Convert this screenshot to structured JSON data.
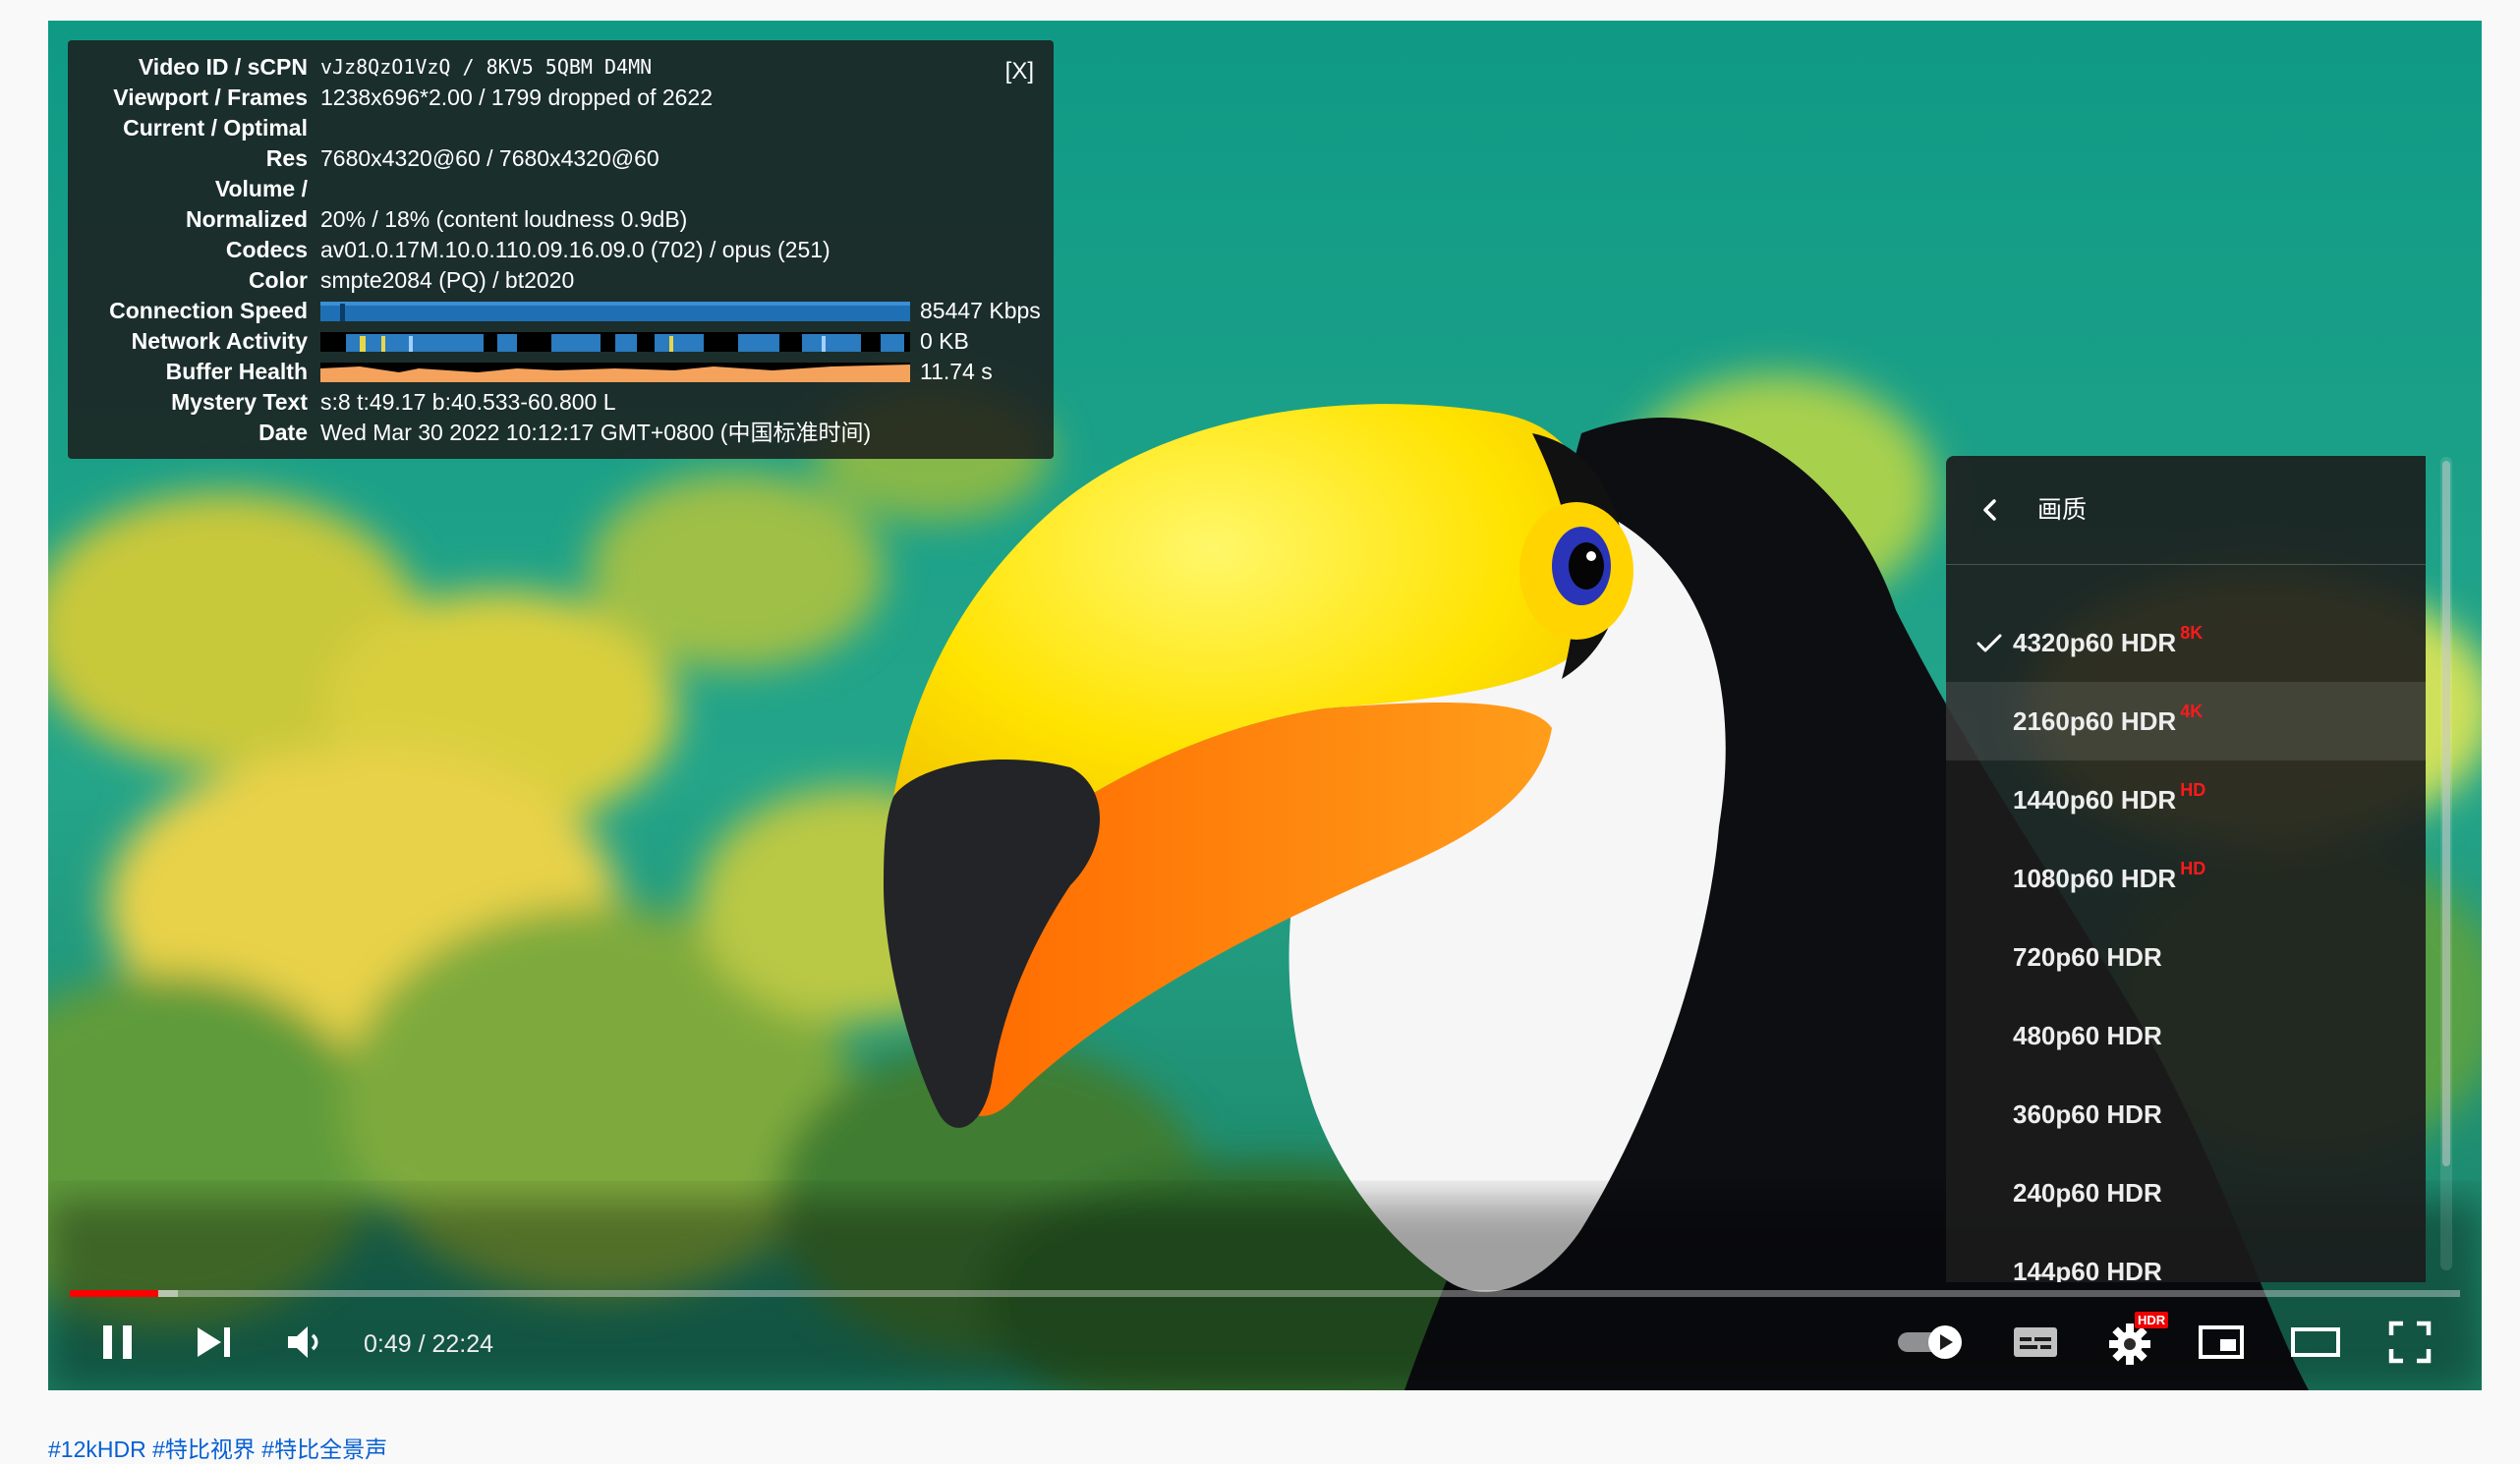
{
  "stats": {
    "close_label": "[X]",
    "rows": [
      {
        "label": "Video ID / sCPN",
        "value": "vJz8QzO1VzQ  /  8KV5 5QBM D4MN"
      },
      {
        "label": "Viewport / Frames",
        "value": "1238x696*2.00 / 1799 dropped of 2622"
      },
      {
        "label": "Current / Optimal",
        "value": ""
      },
      {
        "label": "Res",
        "value": "7680x4320@60 / 7680x4320@60"
      },
      {
        "label": "Volume /",
        "value": ""
      },
      {
        "label": "Normalized",
        "value": "20% / 18% (content loudness 0.9dB)"
      },
      {
        "label": "Codecs",
        "value": "av01.0.17M.10.0.110.09.16.09.0 (702) / opus (251)"
      },
      {
        "label": "Color",
        "value": "smpte2084 (PQ) / bt2020"
      },
      {
        "label": "Connection Speed",
        "value": "85447 Kbps"
      },
      {
        "label": "Network Activity",
        "value": "0 KB"
      },
      {
        "label": "Buffer Health",
        "value": "11.74 s"
      },
      {
        "label": "Mystery Text",
        "value": "s:8 t:49.17 b:40.533-60.800 L"
      },
      {
        "label": "Date",
        "value": "Wed Mar 30 2022 10:12:17 GMT+0800 (中国标准时间)"
      }
    ]
  },
  "quality_menu": {
    "title": "画质",
    "items": [
      {
        "label": "4320p60 HDR",
        "badge": "8K"
      },
      {
        "label": "2160p60 HDR",
        "badge": "4K"
      },
      {
        "label": "1440p60 HDR",
        "badge": "HD"
      },
      {
        "label": "1080p60 HDR",
        "badge": "HD"
      },
      {
        "label": "720p60 HDR",
        "badge": ""
      },
      {
        "label": "480p60 HDR",
        "badge": ""
      },
      {
        "label": "360p60 HDR",
        "badge": ""
      },
      {
        "label": "240p60 HDR",
        "badge": ""
      },
      {
        "label": "144p60 HDR",
        "badge": ""
      }
    ],
    "selected_index": 0,
    "hovered_index": 1
  },
  "controls": {
    "time": "0:49 / 22:24",
    "progress_played_fraction": 0.037,
    "settings_badge": "HDR",
    "icons": [
      "pause-icon",
      "next-icon",
      "volume-icon",
      "autoplay-toggle",
      "subtitles-icon",
      "settings-icon",
      "miniplayer-icon",
      "theater-icon",
      "fullscreen-icon"
    ]
  },
  "footer": {
    "hashtags": "#12kHDR #特比视界 #特比全景声"
  },
  "colors": {
    "progress": "#ff0000",
    "badge": "#ff1a1a",
    "link": "#065fd4"
  }
}
